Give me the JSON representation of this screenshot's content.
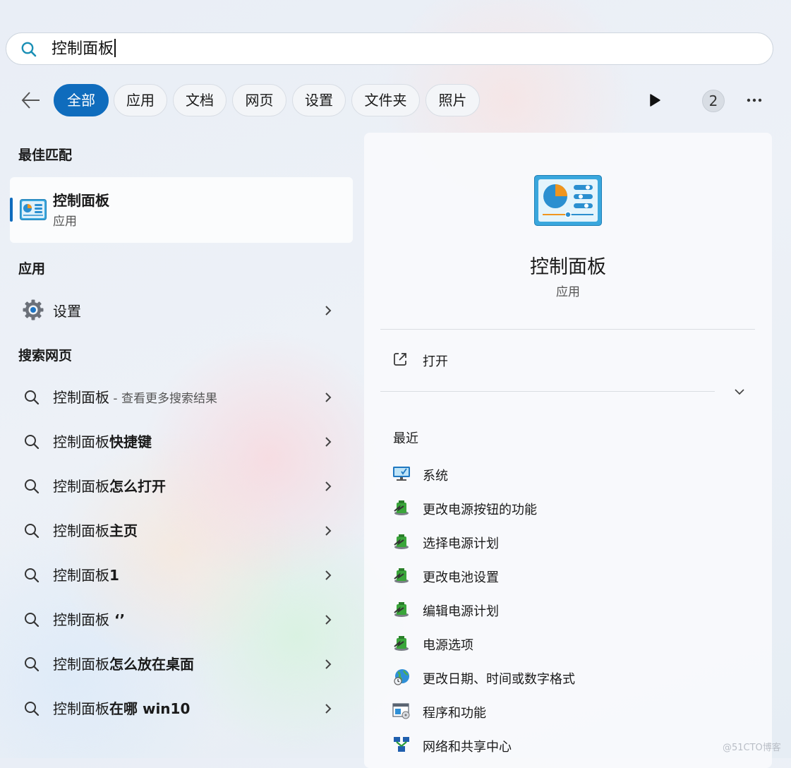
{
  "search": {
    "query": "控制面板"
  },
  "filters": {
    "tabs": [
      "全部",
      "应用",
      "文档",
      "网页",
      "设置",
      "文件夹",
      "照片"
    ],
    "active": "全部",
    "badge": "2"
  },
  "left": {
    "best_match_title": "最佳匹配",
    "best_match": {
      "name": "控制面板",
      "type": "应用"
    },
    "apps_title": "应用",
    "apps": [
      {
        "label": "设置"
      }
    ],
    "web_title": "搜索网页",
    "web_results": [
      {
        "prefix": "控制面板",
        "bold": "",
        "sub": " - 查看更多搜索结果"
      },
      {
        "prefix": "控制面板",
        "bold": "快捷键",
        "sub": ""
      },
      {
        "prefix": "控制面板",
        "bold": "怎么打开",
        "sub": ""
      },
      {
        "prefix": "控制面板",
        "bold": "主页",
        "sub": ""
      },
      {
        "prefix": "控制面板",
        "bold": "1",
        "sub": ""
      },
      {
        "prefix": "控制面板",
        "bold": " ‘’",
        "sub": ""
      },
      {
        "prefix": "控制面板",
        "bold": "怎么放在桌面",
        "sub": ""
      },
      {
        "prefix": "控制面板",
        "bold": "在哪 win10",
        "sub": ""
      }
    ]
  },
  "right": {
    "title": "控制面板",
    "subtitle": "应用",
    "open_label": "打开",
    "recent_title": "最近",
    "recent": [
      {
        "label": "系统",
        "icon": "system-monitor-icon"
      },
      {
        "label": "更改电源按钮的功能",
        "icon": "power-options-icon"
      },
      {
        "label": "选择电源计划",
        "icon": "power-options-icon"
      },
      {
        "label": "更改电池设置",
        "icon": "power-options-icon"
      },
      {
        "label": "编辑电源计划",
        "icon": "power-options-icon"
      },
      {
        "label": "电源选项",
        "icon": "power-options-icon"
      },
      {
        "label": "更改日期、时间或数字格式",
        "icon": "globe-clock-icon"
      },
      {
        "label": "程序和功能",
        "icon": "programs-icon"
      },
      {
        "label": "网络和共享中心",
        "icon": "network-icon"
      }
    ]
  },
  "colors": {
    "accent": "#0f6cbd",
    "search_icon": "#0f8fb8",
    "icon_blue": "#2b9bd8",
    "icon_orange": "#f0951e"
  },
  "watermark": "@51CTO博客"
}
